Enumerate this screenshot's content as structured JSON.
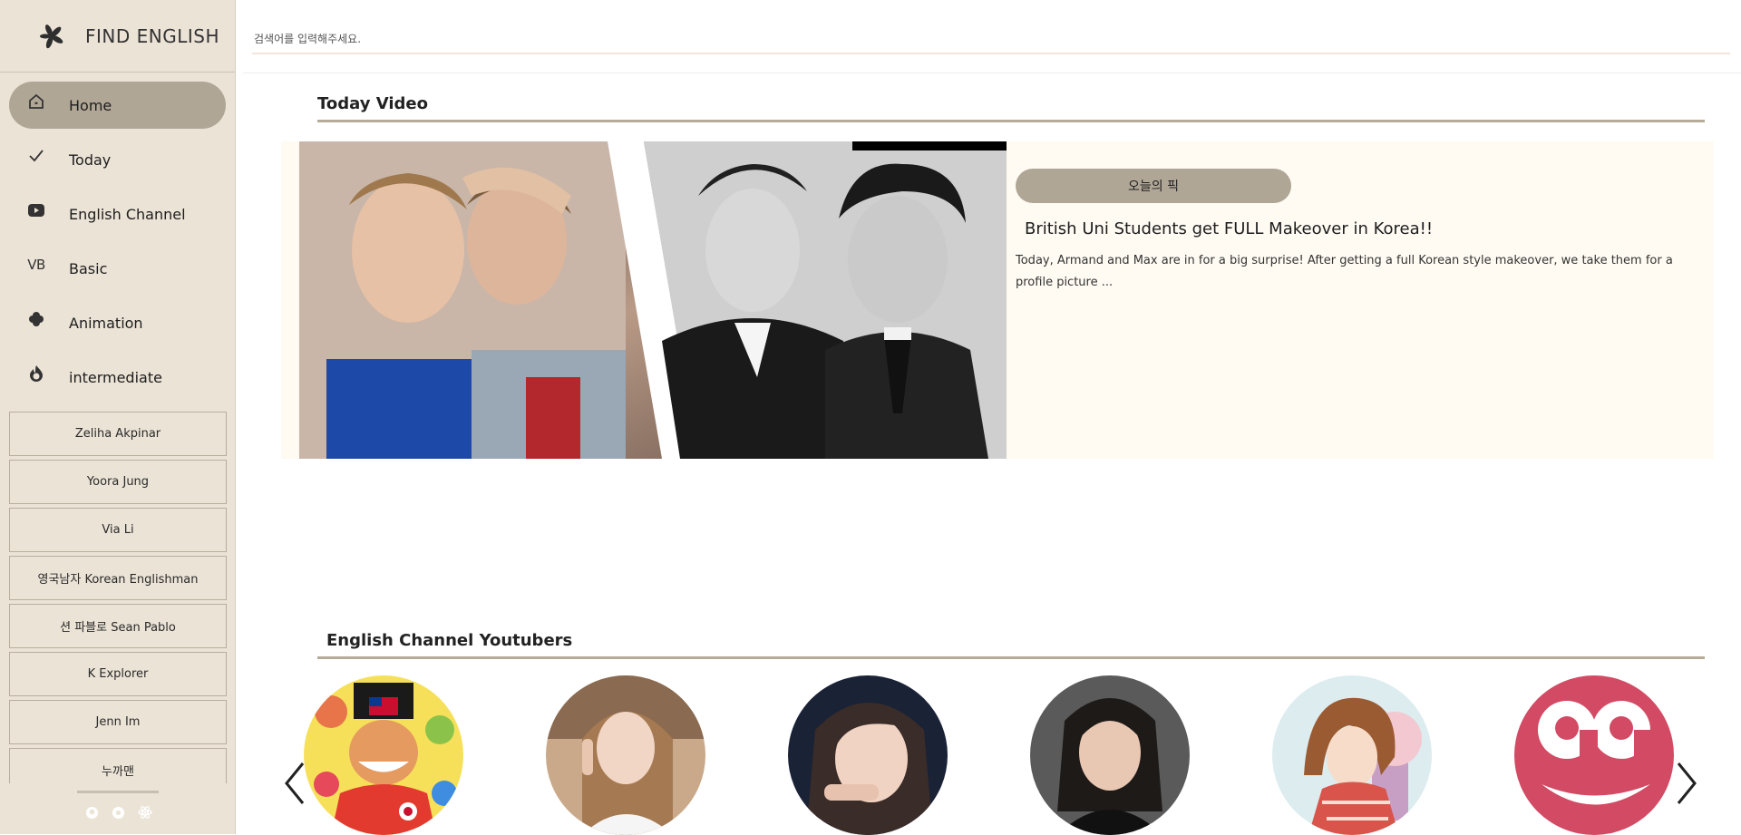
{
  "brand": {
    "name": "FIND ENGLISH"
  },
  "nav": [
    {
      "label": "Home",
      "icon": "home-icon",
      "active": true
    },
    {
      "label": "Today",
      "icon": "check-icon"
    },
    {
      "label": "English Channel",
      "icon": "youtube-icon"
    },
    {
      "label": "Basic",
      "icon": "vb-icon",
      "glyph": "VB"
    },
    {
      "label": "Animation",
      "icon": "clover-icon"
    },
    {
      "label": "intermediate",
      "icon": "fire-icon"
    }
  ],
  "channels": [
    "Zeliha Akpinar",
    "Yoora Jung",
    "Via Li",
    "영국남자 Korean Englishman",
    "션 파블로 Sean Pablo",
    "K Explorer",
    "Jenn Im",
    "누까맨"
  ],
  "footer_icons": [
    "github-icon",
    "chrome-icon",
    "react-icon"
  ],
  "search": {
    "placeholder": "검색어를 입력해주세요."
  },
  "today_video": {
    "section_title": "Today Video",
    "badge": "오늘의 픽",
    "title": "British Uni Students get FULL Makeover in Korea!!",
    "description": "Today, Armand and Max are in for a big surprise! After getting a full Korean style makeover, we take them for a profile picture ..."
  },
  "youtubers": {
    "section_title": "English Channel Youtubers",
    "avatars": [
      "youtuber-avatar-1",
      "youtuber-avatar-2",
      "youtuber-avatar-3",
      "youtuber-avatar-4",
      "youtuber-avatar-5",
      "youtuber-avatar-6"
    ],
    "prev_icon": "chevron-left-icon",
    "next_icon": "chevron-right-icon"
  },
  "colors": {
    "sidebar_bg": "#ebe3d6",
    "accent": "#b0a696",
    "card_bg": "#fffbf3",
    "rule": "#b6aa98"
  }
}
